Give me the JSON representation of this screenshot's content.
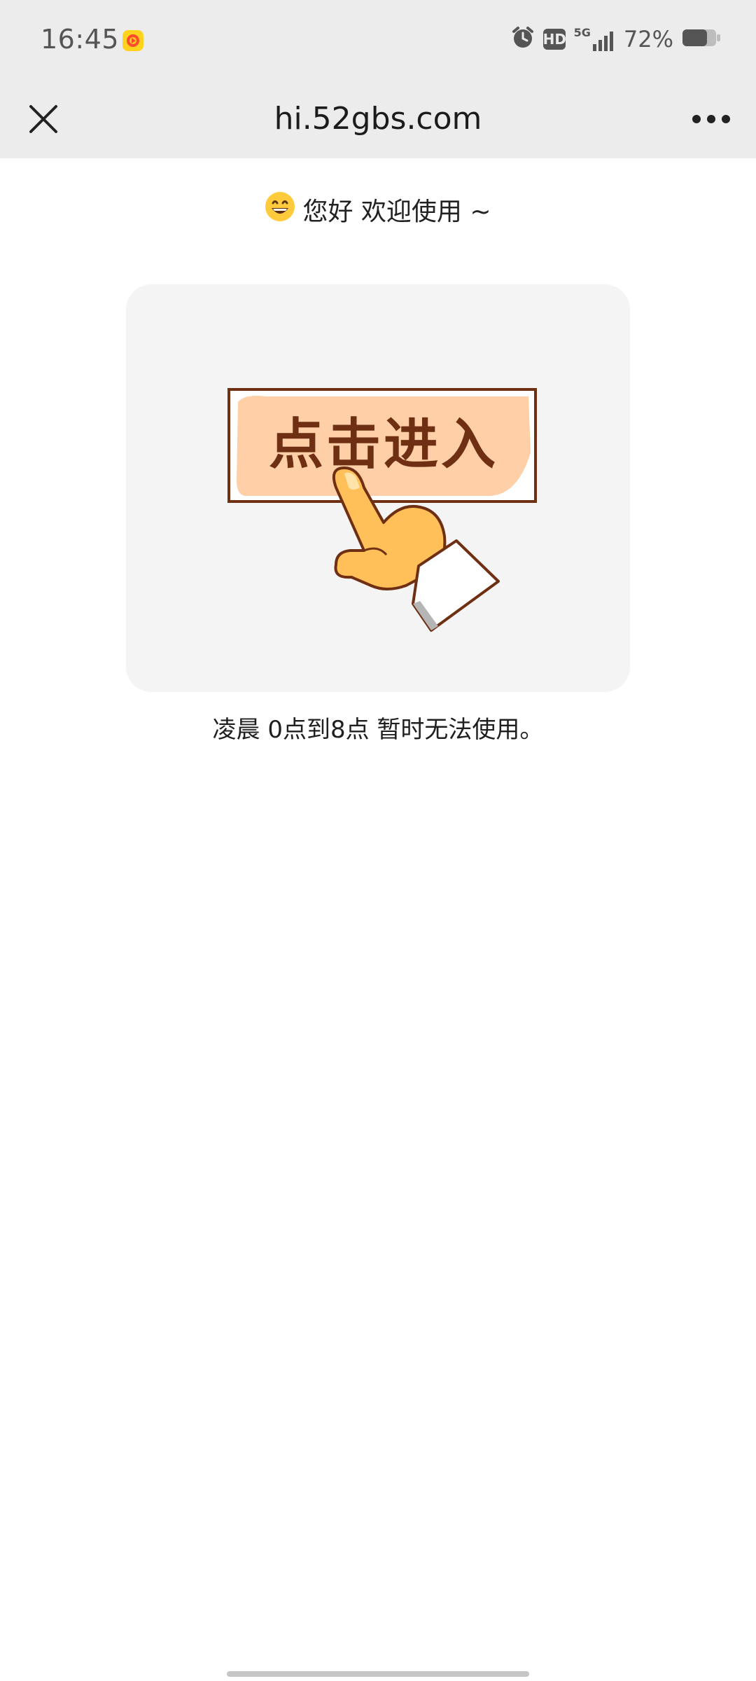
{
  "status_bar": {
    "time": "16:45",
    "battery_percent": "72%",
    "network": "5G",
    "hd_badge": "HD",
    "battery_level": 0.72,
    "icons": [
      "app-notification-icon",
      "alarm-icon",
      "hd-icon",
      "signal-5g-icon",
      "battery-icon"
    ]
  },
  "toolbar": {
    "title": "hi.52gbs.com",
    "close_icon": "close-icon",
    "more_icon": "more-dots-icon"
  },
  "content": {
    "greeting_emoji": "😄",
    "greeting": "您好 欢迎使用 ~",
    "enter_button_text": "点击进入",
    "enter_image_icon": "pointing-hand-icon",
    "notice": "凌晨 0点到8点 暂时无法使用。"
  },
  "colors": {
    "chrome_bg": "#ececec",
    "card_bg": "#f4f4f4",
    "button_fill": "#ffcfa8",
    "button_border": "#6e2f12",
    "hand": "#ffc05a"
  }
}
